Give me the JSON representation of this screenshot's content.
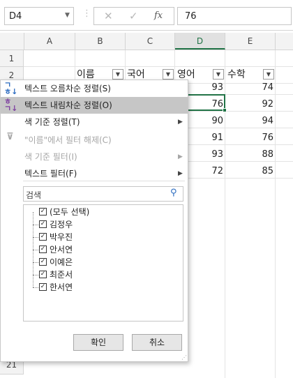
{
  "formula_bar": {
    "name_box": "D4",
    "cancel_icon": "close-icon",
    "enter_icon": "check-icon",
    "fx_label": "fx",
    "formula_value": "76"
  },
  "grid": {
    "columns": [
      "A",
      "B",
      "C",
      "D",
      "E"
    ],
    "selected_column": "D",
    "selected_cell": "D4",
    "rows": [
      "1",
      "2",
      "21"
    ],
    "headers": [
      "이름",
      "국어",
      "영어",
      "수학"
    ],
    "d_values": [
      "93",
      "76",
      "90",
      "91",
      "93",
      "72"
    ],
    "e_values": [
      "74",
      "92",
      "94",
      "76",
      "88",
      "85"
    ]
  },
  "filter_menu": {
    "sort_asc": "텍스트 오름차순 정렬(S)",
    "sort_desc": "텍스트 내림차순 정렬(O)",
    "sort_by_color": "색 기준 정렬(T)",
    "clear_filter": "\"이름\"에서 필터 해제(C)",
    "filter_by_color": "색 기준 필터(I)",
    "text_filter": "텍스트 필터(F)",
    "search_placeholder": "검색",
    "items": [
      "(모두 선택)",
      "김정우",
      "박우진",
      "안서연",
      "이예은",
      "최준서",
      "한서연"
    ],
    "ok_button": "확인",
    "cancel_button": "취소"
  }
}
